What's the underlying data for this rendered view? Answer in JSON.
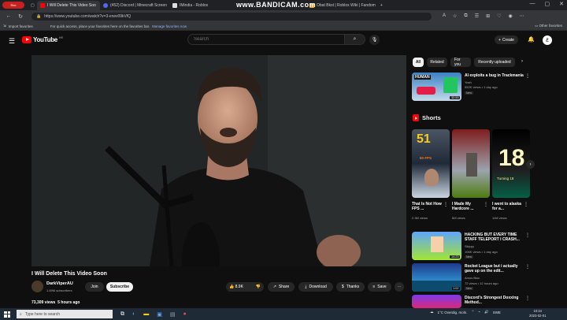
{
  "browser": {
    "recorder": "Rec",
    "tabs": [
      {
        "title": "I Will Delete This Video Soo",
        "active": true,
        "color": "#ff0000"
      },
      {
        "title": "(452) Discord | Minecraft Screen",
        "active": false,
        "color": "#5865f2"
      },
      {
        "title": "IMindia - Roblox",
        "active": false,
        "color": "#ffffff"
      },
      {
        "title": "Obat Bkst | Roblox Wiki | Fandom",
        "active": false,
        "color": "#ff9900"
      }
    ],
    "watermark": "www.BANDICAM.com",
    "url": "https://www.youtube.com/watch?v=3-erwv09kVfQ",
    "bookmarks": {
      "import": "Import favorites",
      "hint": "For quick access, place your favorites here on the favorites bar.",
      "manage": "Manage favorites now",
      "other": "Other favorites"
    }
  },
  "header": {
    "logo": "YouTube",
    "country": "HR",
    "search_placeholder": "Search",
    "create": "Create"
  },
  "video": {
    "title": "I Will Delete This Video Soon",
    "channel": "DarkViperAU",
    "subscribers": "1.69M subscribers",
    "join": "Join",
    "subscribe": "Subscribe",
    "likes": "8.9K",
    "share": "Share",
    "download": "Download",
    "thanks": "Thanks",
    "save": "Save",
    "views": "73,309 views",
    "age": "5 hours ago"
  },
  "chips": [
    "All",
    "Related",
    "For you",
    "Recently uploaded"
  ],
  "recommended": [
    {
      "title": "AI exploits a bug in Trackmania",
      "channel": "Yosh",
      "views": "552K views",
      "age": "1 day ago",
      "badge": "New",
      "duration": "32:53",
      "thumb_text": "HUMAN"
    }
  ],
  "shorts": {
    "heading": "Shorts",
    "items": [
      {
        "title": "That Is Not How FPS ...",
        "views": "2.3M views",
        "thumb_text": "51",
        "thumb_sub": "60 FPS"
      },
      {
        "title": "I Made My Hardcore ...",
        "views": "6M views",
        "thumb_text": "",
        "thumb_sub": ""
      },
      {
        "title": "I went to alaska for a...",
        "views": "11M views",
        "thumb_text": "18",
        "thumb_sub": "Turning 18"
      }
    ]
  },
  "recommended2": [
    {
      "title": "HACKING BUT EVERY TIME",
      "title2": "STAFF TELEPORT I CRASH...",
      "channel": "Skippy",
      "views": "106K views",
      "age": "1 day ago",
      "badge": "New",
      "duration": "14:23"
    },
    {
      "title": "Rocket League but i actually",
      "title2": "gave up on the edit...",
      "channel": "Amos Bloc",
      "views": "72 views",
      "age": "12 hours ago",
      "badge": "New",
      "duration": "1:02"
    },
    {
      "title": "Discord's Strongest Doxxing",
      "title2": "Method...",
      "channel": "",
      "views": "",
      "age": "",
      "badge": "",
      "duration": ""
    }
  ],
  "taskbar": {
    "search": "Type here to search",
    "weather": "1°C  Overdig. moln.",
    "lang": "SWE",
    "time": "10:34",
    "date": "2023-02-01"
  }
}
